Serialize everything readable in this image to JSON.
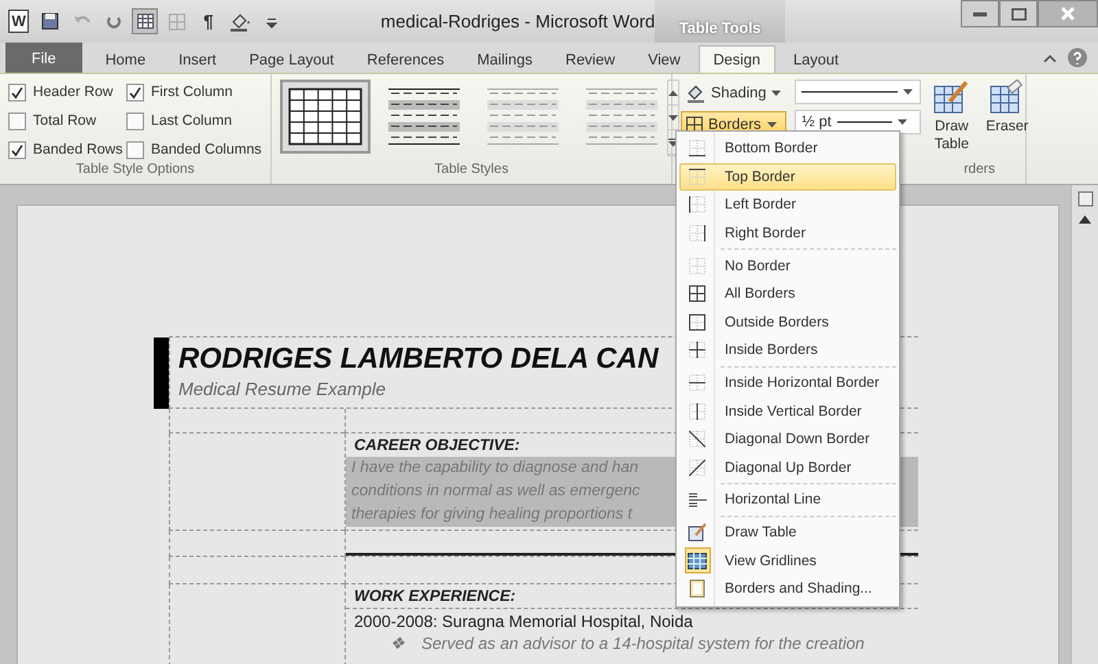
{
  "app_logo": "W",
  "quick_access": {
    "pilcrow": "¶",
    "table_button_on": true
  },
  "window": {
    "title": "medical-Rodriges - Microsoft Word",
    "context_title": "Table Tools"
  },
  "tabs": [
    {
      "label": "File",
      "kind": "file",
      "selected": false
    },
    {
      "label": "Home",
      "kind": "tab",
      "selected": false
    },
    {
      "label": "Insert",
      "kind": "tab",
      "selected": false
    },
    {
      "label": "Page Layout",
      "kind": "tab",
      "selected": false
    },
    {
      "label": "References",
      "kind": "tab",
      "selected": false
    },
    {
      "label": "Mailings",
      "kind": "tab",
      "selected": false
    },
    {
      "label": "Review",
      "kind": "tab",
      "selected": false
    },
    {
      "label": "View",
      "kind": "tab",
      "selected": false
    },
    {
      "label": "Design",
      "kind": "context",
      "selected": true
    },
    {
      "label": "Layout",
      "kind": "context",
      "selected": false
    }
  ],
  "table_style_options": {
    "label": "Table Style Options",
    "options": [
      {
        "label": "Header Row",
        "checked": true
      },
      {
        "label": "First Column",
        "checked": true
      },
      {
        "label": "Total Row",
        "checked": false
      },
      {
        "label": "Last Column",
        "checked": false
      },
      {
        "label": "Banded Rows",
        "checked": true
      },
      {
        "label": "Banded Columns",
        "checked": false
      }
    ]
  },
  "table_styles": {
    "label": "Table Styles",
    "styles": [
      {
        "selected": true
      },
      {
        "selected": false
      },
      {
        "selected": false
      },
      {
        "selected": false
      }
    ]
  },
  "draw_borders": {
    "shading": "Shading",
    "borders": "Borders",
    "borders_open": true,
    "pen_weight": "½ pt",
    "draw_table": "Draw Table",
    "eraser": "Eraser",
    "label": "rders"
  },
  "borders_menu": [
    {
      "label": "Bottom Border",
      "selected": false,
      "checked": false,
      "divider_above": false
    },
    {
      "label": "Top Border",
      "selected": true,
      "checked": false,
      "divider_above": false
    },
    {
      "label": "Left Border",
      "selected": false,
      "checked": false,
      "divider_above": false
    },
    {
      "label": "Right Border",
      "selected": false,
      "checked": false,
      "divider_above": false
    },
    {
      "label": "No Border",
      "selected": false,
      "checked": false,
      "divider_above": true
    },
    {
      "label": "All Borders",
      "selected": false,
      "checked": false,
      "divider_above": false
    },
    {
      "label": "Outside Borders",
      "selected": false,
      "checked": false,
      "divider_above": false
    },
    {
      "label": "Inside Borders",
      "selected": false,
      "checked": false,
      "divider_above": false
    },
    {
      "label": "Inside Horizontal Border",
      "selected": false,
      "checked": false,
      "divider_above": true
    },
    {
      "label": "Inside Vertical Border",
      "selected": false,
      "checked": false,
      "divider_above": false
    },
    {
      "label": "Diagonal Down Border",
      "selected": false,
      "checked": false,
      "divider_above": false
    },
    {
      "label": "Diagonal Up Border",
      "selected": false,
      "checked": false,
      "divider_above": false
    },
    {
      "label": "Horizontal Line",
      "selected": false,
      "checked": false,
      "divider_above": true
    },
    {
      "label": "Draw Table",
      "selected": false,
      "checked": false,
      "divider_above": true
    },
    {
      "label": "View Gridlines",
      "selected": false,
      "checked": true,
      "divider_above": false
    },
    {
      "label": "Borders and Shading...",
      "selected": false,
      "checked": false,
      "divider_above": false
    }
  ],
  "document": {
    "name": "RODRIGES LAMBERTO DELA CAN",
    "subtitle": "Medical Resume Example",
    "career_heading": "CAREER OBJECTIVE:",
    "career_lines": [
      "I have the capability to diagnose and han",
      "conditions in normal as well as emergenc",
      "therapies for giving healing proportions t"
    ],
    "work_heading": "WORK EXPERIENCE:",
    "job": "2000-2008: Suragna Memorial Hospital, Noida",
    "bullets": [
      {
        "marker": "❖",
        "text": "Served as an advisor to a 14-hospital system for the creation"
      }
    ]
  }
}
